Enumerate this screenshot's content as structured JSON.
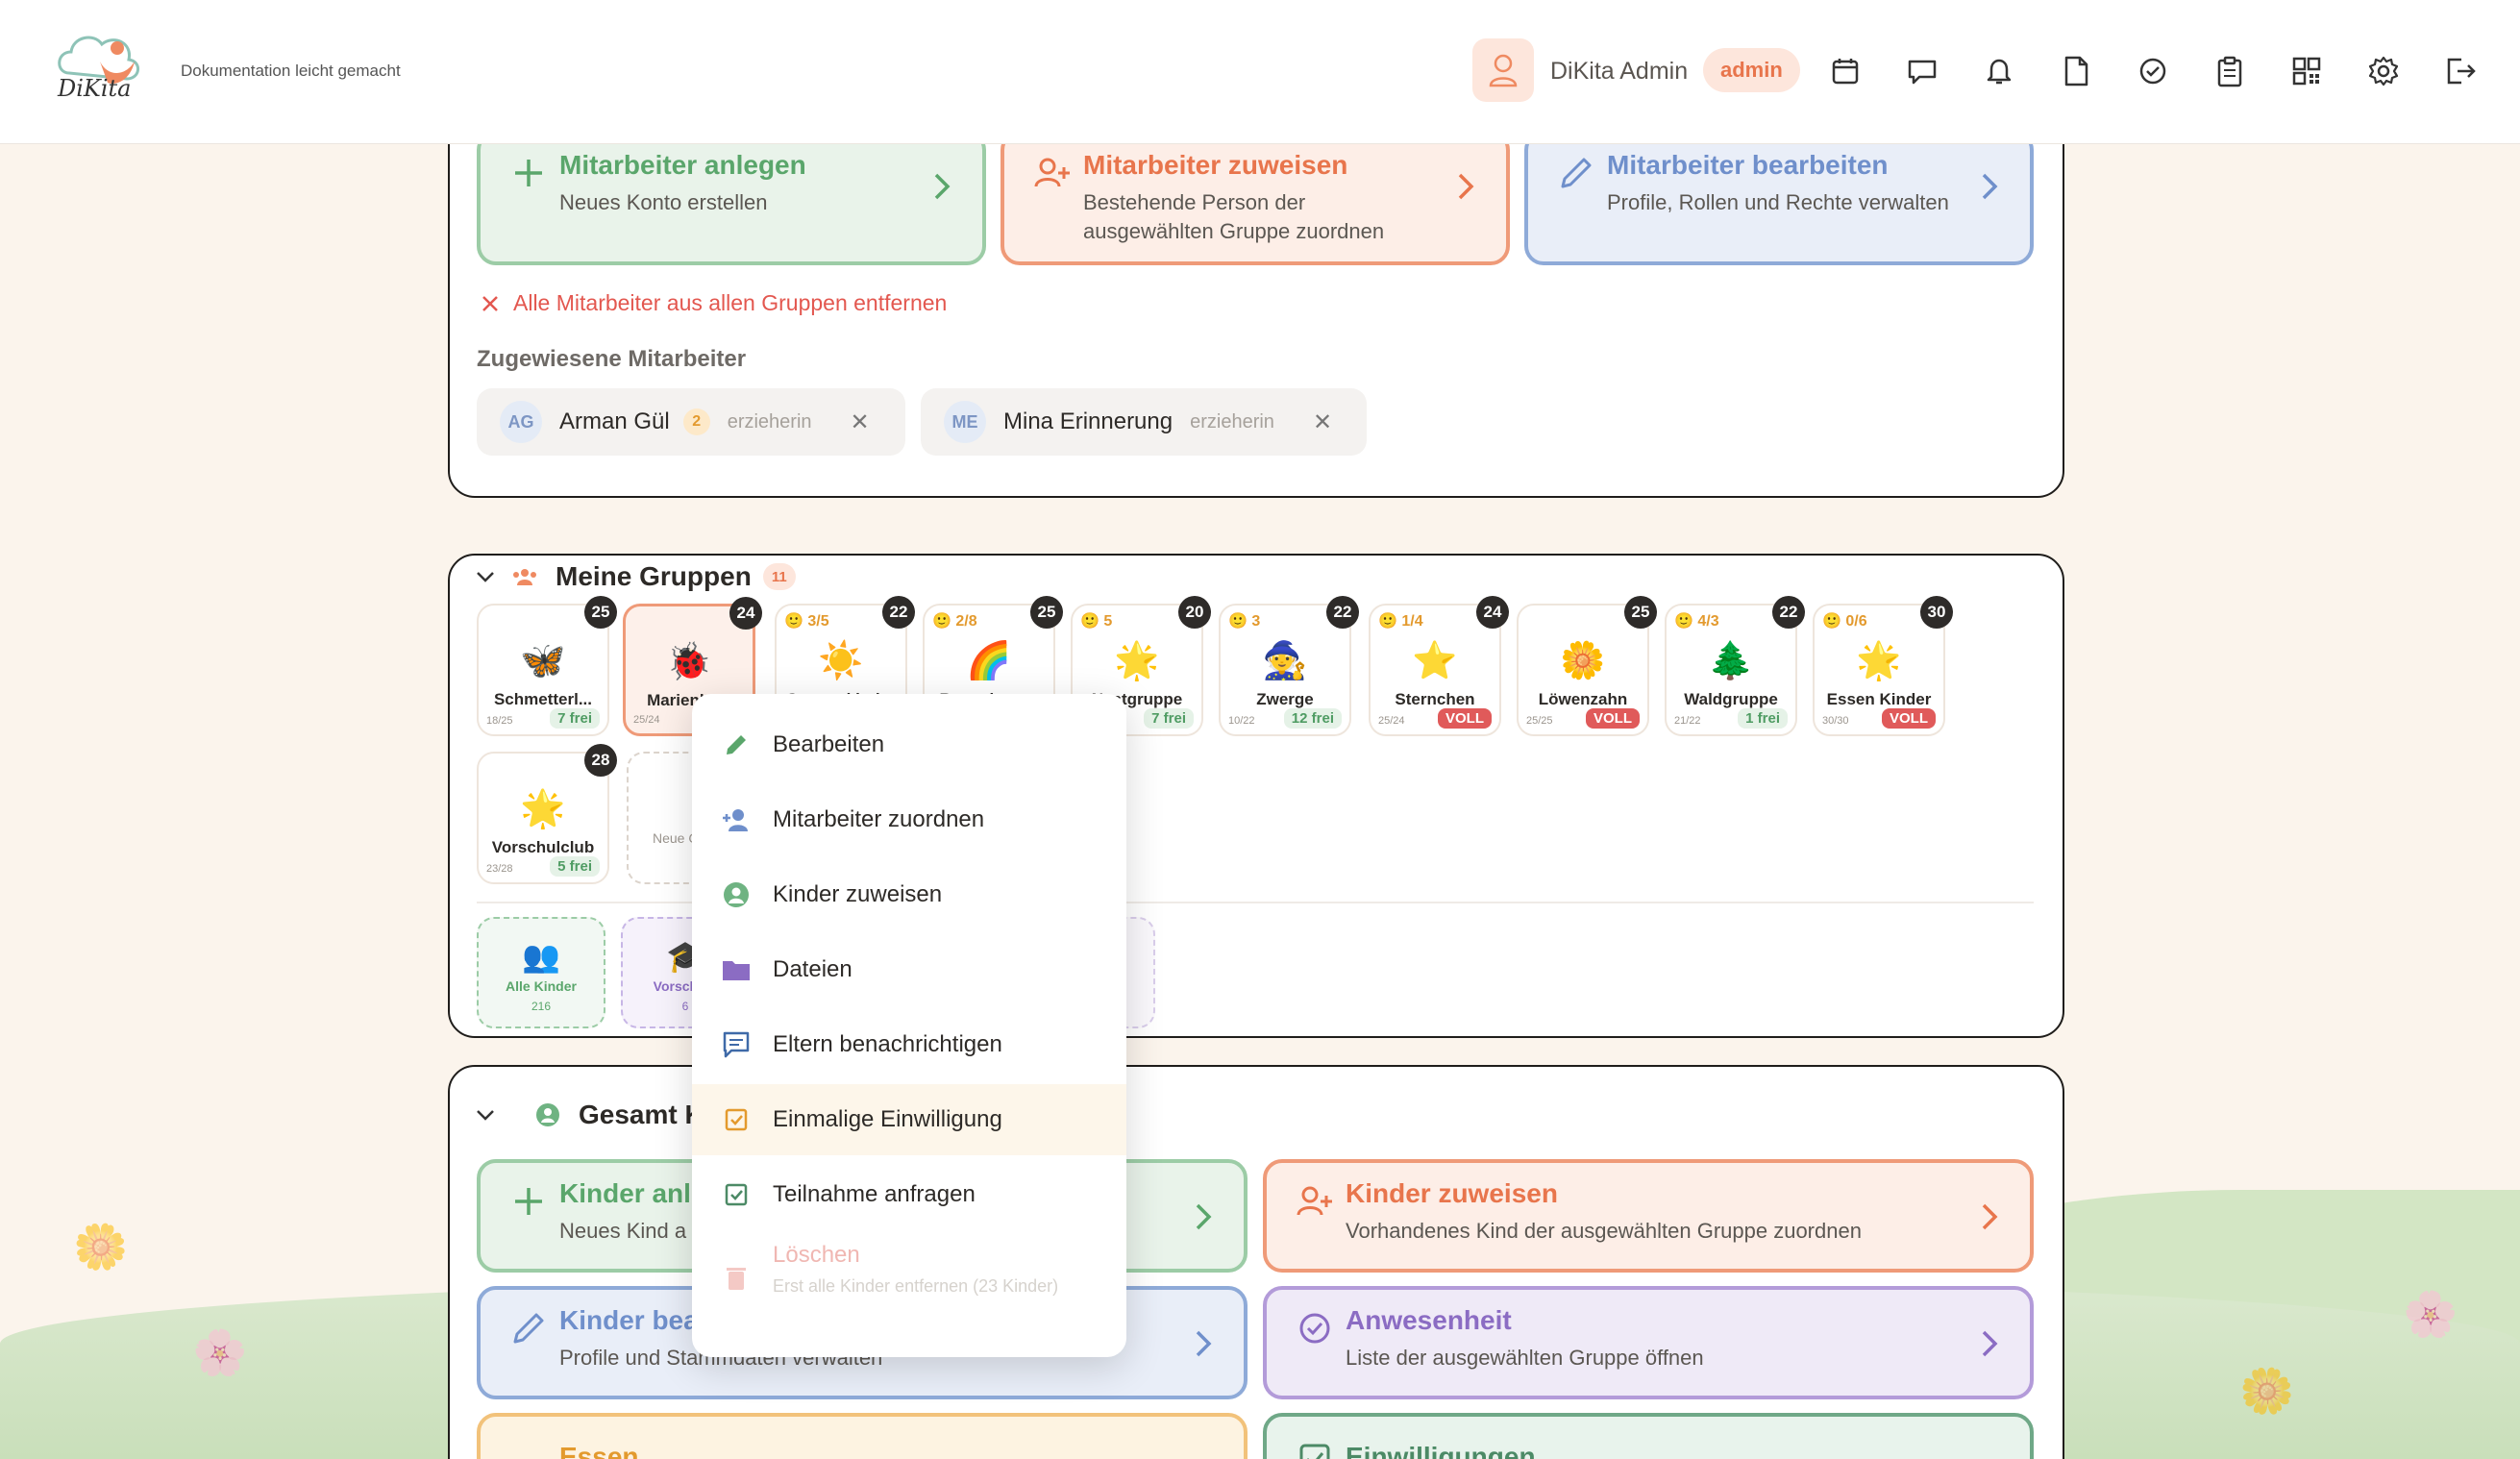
{
  "header": {
    "logo_text": "DiKita",
    "tagline": "Dokumentation leicht gemacht",
    "user_name": "DiKita Admin",
    "role": "admin",
    "icons": [
      "calendar-icon",
      "chat-icon",
      "bell-icon",
      "document-icon",
      "check-circle-icon",
      "clipboard-icon",
      "qr-code-icon",
      "gear-icon",
      "logout-icon"
    ]
  },
  "staff_panel": {
    "actions": [
      {
        "title": "Mitarbeiter anlegen",
        "subtitle": "Neues Konto erstellen"
      },
      {
        "title": "Mitarbeiter zuweisen",
        "subtitle": "Bestehende Person der ausgewählten Gruppe zuordnen"
      },
      {
        "title": "Mitarbeiter bearbeiten",
        "subtitle": "Profile, Rollen und Rechte verwalten"
      }
    ],
    "remove_all": "Alle Mitarbeiter aus allen Gruppen entfernen",
    "assigned_label": "Zugewiesene Mitarbeiter",
    "staff": [
      {
        "initials": "AG",
        "name": "Arman Gül",
        "count": "2",
        "role": "erzieherin"
      },
      {
        "initials": "ME",
        "name": "Mina Erinnerung",
        "role": "erzieherin"
      }
    ]
  },
  "groups_panel": {
    "title": "Meine Gruppen",
    "count": "11",
    "groups": [
      {
        "emoji": "🦋",
        "name": "Schmetterl...",
        "occ": "18/25",
        "free": "7 frei",
        "badge": "25"
      },
      {
        "emoji": "🐞",
        "name": "Marienkä...",
        "occ": "25/24",
        "badge": "24"
      },
      {
        "emoji": "☀️",
        "name": "Sonnenkinder",
        "ratio": "3/5",
        "badge": "22"
      },
      {
        "emoji": "🌈",
        "name": "Regenbogen",
        "ratio": "2/8",
        "badge": "25"
      },
      {
        "emoji": "🌟",
        "name": "Nestgruppe",
        "ratio": "5",
        "free": "7 frei",
        "badge": "20"
      },
      {
        "emoji": "🧙",
        "name": "Zwerge",
        "ratio": "3",
        "occ": "10/22",
        "free": "12 frei",
        "badge": "22"
      },
      {
        "emoji": "⭐",
        "name": "Sternchen",
        "ratio": "1/4",
        "occ": "25/24",
        "free": "VOLL",
        "badge": "24"
      },
      {
        "emoji": "🌼",
        "name": "Löwenzahn",
        "occ": "25/25",
        "free": "VOLL",
        "badge": "25"
      },
      {
        "emoji": "🌲",
        "name": "Waldgruppe",
        "ratio": "4/3",
        "occ": "21/22",
        "free": "1 frei",
        "badge": "22"
      },
      {
        "emoji": "🌟",
        "name": "Essen Kinder",
        "ratio": "0/6",
        "occ": "30/30",
        "free": "VOLL",
        "badge": "30"
      },
      {
        "emoji": "🌟",
        "name": "Vorschulclub",
        "occ": "23/28",
        "free": "5 frei",
        "badge": "28"
      }
    ],
    "new_group": "Neue Gruppe",
    "filters": [
      {
        "emoji": "👥",
        "label": "Alle Kinder",
        "count": "216"
      },
      {
        "emoji": "🎓",
        "label": "Vorschule",
        "count": "6"
      }
    ]
  },
  "context_menu": {
    "items": [
      {
        "label": "Bearbeiten"
      },
      {
        "label": "Mitarbeiter zuordnen"
      },
      {
        "label": "Kinder zuweisen"
      },
      {
        "label": "Dateien"
      },
      {
        "label": "Eltern benachrichtigen"
      },
      {
        "label": "Einmalige Einwilligung"
      },
      {
        "label": "Teilnahme anfragen"
      },
      {
        "label": "Löschen",
        "sub": "Erst alle Kinder entfernen (23 Kinder)"
      }
    ]
  },
  "children_panel": {
    "title": "Gesamt K",
    "actions": [
      {
        "title": "Kinder anl",
        "subtitle": "Neues Kind a"
      },
      {
        "title": "Kinder zuweisen",
        "subtitle": "Vorhandenes Kind der ausgewählten Gruppe zuordnen"
      },
      {
        "title": "Kinder bea",
        "subtitle": "Profile und Stammdaten verwalten"
      },
      {
        "title": "Anwesenheit",
        "subtitle": "Liste der ausgewählten Gruppe öffnen"
      },
      {
        "title": "Essen"
      },
      {
        "title": "Einwilligungen"
      }
    ]
  }
}
